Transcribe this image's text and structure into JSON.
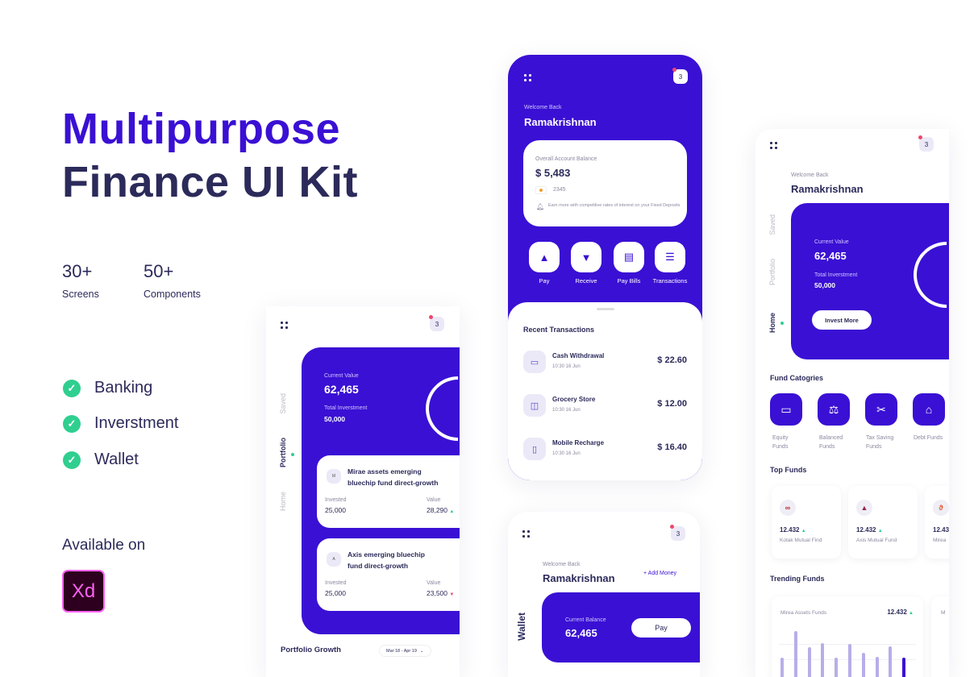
{
  "hero": {
    "title_line1": "Multipurpose",
    "title_line2": "Finance UI Kit",
    "title_color": "#3a10d4"
  },
  "stats": [
    {
      "value": "30+",
      "label": "Screens"
    },
    {
      "value": "50+",
      "label": "Components"
    }
  ],
  "features": [
    "Banking",
    "Inverstment",
    "Wallet"
  ],
  "available": {
    "label": "Available on",
    "logo_text": "Xd"
  },
  "common": {
    "welcome": "Welcome Back",
    "user": "Ramakrishnan",
    "notifications": "3",
    "accent": "#3a10d4"
  },
  "portfolio_screen": {
    "tabs": [
      "Saved",
      "Portfolio",
      "Home"
    ],
    "active_tab": "Portfolio",
    "current_value_label": "Current Value",
    "current_value": "62,465",
    "total_investment_label": "Total Inverstment",
    "total_investment": "50,000",
    "funds": [
      {
        "initial": "M",
        "name_line1": "Mirae assets emerging",
        "name_line2": "bluechip fund direct-growth",
        "invested_label": "Invested",
        "invested": "25,000",
        "value_label": "Value",
        "value": "28,290",
        "trend": "up"
      },
      {
        "initial": "A",
        "name_line1": "Axis emerging bluechip",
        "name_line2": "fund direct-growth",
        "invested_label": "Invested",
        "invested": "25,000",
        "value_label": "Value",
        "value": "23,500",
        "trend": "down"
      }
    ],
    "growth_title": "Portfolio Growth",
    "date_range": "Mar 18 - Apr 19"
  },
  "home_screen": {
    "balance_label": "Overall Account Balance",
    "balance": "$ 5,483",
    "card_last4": "2345",
    "promo": "Earn more with competitive rates of interest on your Fixed Deposits",
    "actions": [
      {
        "label": "Pay",
        "icon": "arrow-up-icon"
      },
      {
        "label": "Receive",
        "icon": "arrow-down-icon"
      },
      {
        "label": "Pay Bills",
        "icon": "bill-icon"
      },
      {
        "label": "Transactions",
        "icon": "list-icon"
      }
    ],
    "recent_title": "Recent Transactions",
    "transactions": [
      {
        "name": "Cash Withdrawal",
        "time": "10:30 16 Jun",
        "amount": "$ 22.60",
        "icon": "cash-icon"
      },
      {
        "name": "Grocery Store",
        "time": "10:30 16 Jun",
        "amount": "$ 12.00",
        "icon": "bag-icon"
      },
      {
        "name": "Mobile Recharge",
        "time": "10:30 16 Jun",
        "amount": "$ 16.40",
        "icon": "phone-icon"
      }
    ]
  },
  "wallet_screen": {
    "side_label": "Wallet",
    "add_money": "+ Add Money",
    "balance_label": "Current Balance",
    "balance": "62,465",
    "pay": "Pay"
  },
  "invest_screen": {
    "tabs": [
      "Saved",
      "Portfolio",
      "Home"
    ],
    "active_tab": "Home",
    "current_value_label": "Current Value",
    "current_value": "62,465",
    "total_investment_label": "Total Inverstment",
    "total_investment": "50,000",
    "invest_more": "Invest More",
    "categories_title": "Fund Catogries",
    "categories": [
      {
        "line1": "Equity",
        "line2": "Funds"
      },
      {
        "line1": "Balanced",
        "line2": "Funds"
      },
      {
        "line1": "Tax Saving",
        "line2": "Funds"
      },
      {
        "line1": "Debt Funds",
        "line2": ""
      }
    ],
    "top_funds_title": "Top Funds",
    "top_funds": [
      {
        "value": "12.432",
        "name": "Kotak Mutual Find"
      },
      {
        "value": "12.432",
        "name": "Axis Mutual Fund"
      },
      {
        "value": "12.43",
        "name": "Mirea"
      }
    ],
    "trending_title": "Trending Funds",
    "trending": [
      {
        "name": "Mirea Assets Funds",
        "value": "12.432",
        "bar_levels": [
          0.42,
          1.0,
          0.65,
          0.74,
          0.42,
          0.72,
          0.53,
          0.44,
          0.67,
          0.42
        ]
      },
      {
        "name": "M",
        "value": ""
      }
    ]
  }
}
